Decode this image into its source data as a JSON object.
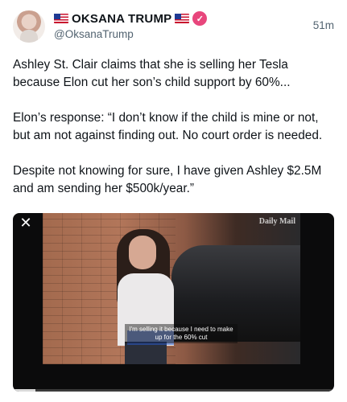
{
  "post": {
    "display_name": "OKSANA TRUMP",
    "handle": "@OksanaTrump",
    "time": "51m",
    "paragraphs": [
      "Ashley St. Clair claims that she is selling her Tesla because Elon cut her son’s child support by 60%...",
      "Elon’s response: “I don’t know if the child is mine or not, but am not against finding out. No court order is needed.",
      "Despite not knowing for sure, I have given Ashley $2.5M and am sending her $500k/year.”"
    ]
  },
  "media": {
    "watermark": "Daily Mail",
    "caption": "I'm selling it because I need to make up for the 60% cut",
    "close_icon": "close-icon",
    "progress_fraction": 0.07
  },
  "colors": {
    "verified_badge": "#e8467c",
    "secondary_text": "#536471"
  }
}
